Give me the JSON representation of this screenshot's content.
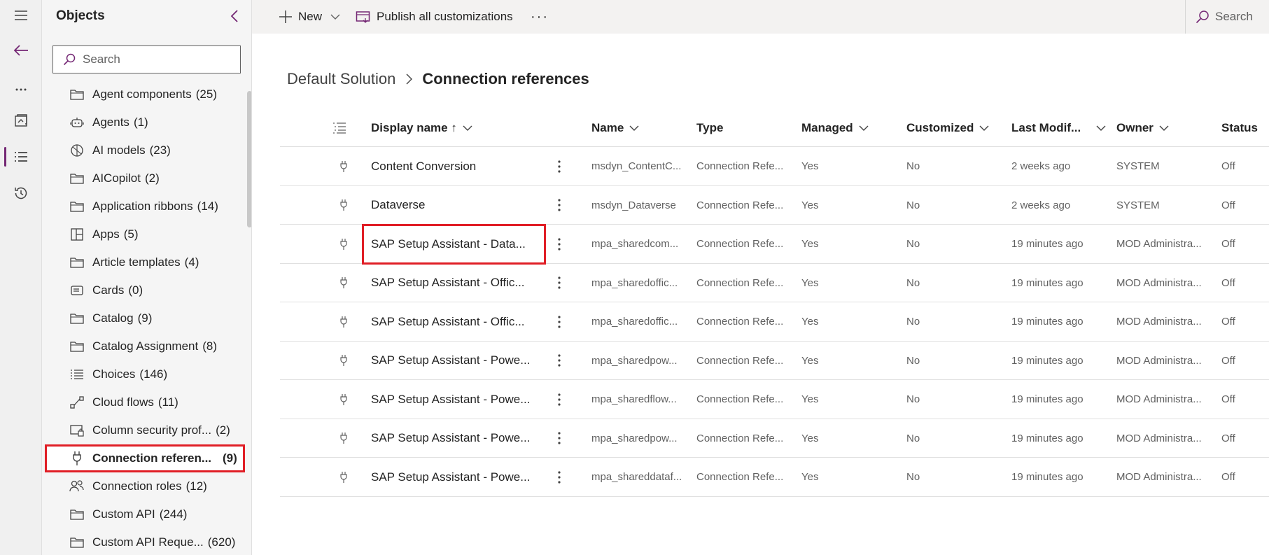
{
  "rail": {
    "items": [
      {
        "icon": "hamburger-menu-icon"
      },
      {
        "icon": "back-arrow-icon"
      },
      {
        "icon": "more-dots-icon"
      },
      {
        "icon": "solution-icon"
      },
      {
        "icon": "objects-list-icon"
      },
      {
        "icon": "history-icon"
      }
    ]
  },
  "objects": {
    "title": "Objects",
    "search_placeholder": "Search",
    "items": [
      {
        "label": "Agent components",
        "count": "(25)",
        "icon": "folder-icon"
      },
      {
        "label": "Agents",
        "count": "(1)",
        "icon": "bot-icon"
      },
      {
        "label": "AI models",
        "count": "(23)",
        "icon": "ai-model-icon"
      },
      {
        "label": "AICopilot",
        "count": "(2)",
        "icon": "folder-icon"
      },
      {
        "label": "Application ribbons",
        "count": "(14)",
        "icon": "folder-icon"
      },
      {
        "label": "Apps",
        "count": "(5)",
        "icon": "apps-icon"
      },
      {
        "label": "Article templates",
        "count": "(4)",
        "icon": "folder-icon"
      },
      {
        "label": "Cards",
        "count": "(0)",
        "icon": "card-icon"
      },
      {
        "label": "Catalog",
        "count": "(9)",
        "icon": "folder-icon"
      },
      {
        "label": "Catalog Assignment",
        "count": "(8)",
        "icon": "folder-icon"
      },
      {
        "label": "Choices",
        "count": "(146)",
        "icon": "list-icon"
      },
      {
        "label": "Cloud flows",
        "count": "(11)",
        "icon": "flow-icon"
      },
      {
        "label": "Column security prof...",
        "count": "(2)",
        "icon": "security-profile-icon"
      },
      {
        "label": "Connection referen...",
        "count": "(9)",
        "icon": "plug-icon",
        "selected": true
      },
      {
        "label": "Connection roles",
        "count": "(12)",
        "icon": "people-icon"
      },
      {
        "label": "Custom API",
        "count": "(244)",
        "icon": "folder-icon"
      },
      {
        "label": "Custom API Reque...",
        "count": "(620)",
        "icon": "folder-icon"
      }
    ]
  },
  "commandbar": {
    "new_label": "New",
    "publish_label": "Publish all customizations",
    "more_label": "···",
    "search_label": "Search"
  },
  "breadcrumb": {
    "root": "Default Solution",
    "current": "Connection references"
  },
  "grid": {
    "headers": {
      "display_name": "Display name ↑",
      "name": "Name",
      "type": "Type",
      "managed": "Managed",
      "customized": "Customized",
      "last_modified": "Last Modif...",
      "owner": "Owner",
      "status": "Status"
    },
    "rows": [
      {
        "display_name": "Content Conversion",
        "name": "msdyn_ContentC...",
        "type": "Connection Refe...",
        "managed": "Yes",
        "customized": "No",
        "last_modified": "2 weeks ago",
        "owner": "SYSTEM",
        "status": "Off"
      },
      {
        "display_name": "Dataverse",
        "name": "msdyn_Dataverse",
        "type": "Connection Refe...",
        "managed": "Yes",
        "customized": "No",
        "last_modified": "2 weeks ago",
        "owner": "SYSTEM",
        "status": "Off"
      },
      {
        "display_name": "SAP Setup Assistant - Data...",
        "name": "mpa_sharedcom...",
        "type": "Connection Refe...",
        "managed": "Yes",
        "customized": "No",
        "last_modified": "19 minutes ago",
        "owner": "MOD Administra...",
        "status": "Off",
        "highlight": true
      },
      {
        "display_name": "SAP Setup Assistant - Offic...",
        "name": "mpa_sharedoffic...",
        "type": "Connection Refe...",
        "managed": "Yes",
        "customized": "No",
        "last_modified": "19 minutes ago",
        "owner": "MOD Administra...",
        "status": "Off"
      },
      {
        "display_name": "SAP Setup Assistant - Offic...",
        "name": "mpa_sharedoffic...",
        "type": "Connection Refe...",
        "managed": "Yes",
        "customized": "No",
        "last_modified": "19 minutes ago",
        "owner": "MOD Administra...",
        "status": "Off"
      },
      {
        "display_name": "SAP Setup Assistant - Powe...",
        "name": "mpa_sharedpow...",
        "type": "Connection Refe...",
        "managed": "Yes",
        "customized": "No",
        "last_modified": "19 minutes ago",
        "owner": "MOD Administra...",
        "status": "Off"
      },
      {
        "display_name": "SAP Setup Assistant - Powe...",
        "name": "mpa_sharedflow...",
        "type": "Connection Refe...",
        "managed": "Yes",
        "customized": "No",
        "last_modified": "19 minutes ago",
        "owner": "MOD Administra...",
        "status": "Off"
      },
      {
        "display_name": "SAP Setup Assistant - Powe...",
        "name": "mpa_sharedpow...",
        "type": "Connection Refe...",
        "managed": "Yes",
        "customized": "No",
        "last_modified": "19 minutes ago",
        "owner": "MOD Administra...",
        "status": "Off"
      },
      {
        "display_name": "SAP Setup Assistant - Powe...",
        "name": "mpa_shareddataf...",
        "type": "Connection Refe...",
        "managed": "Yes",
        "customized": "No",
        "last_modified": "19 minutes ago",
        "owner": "MOD Administra...",
        "status": "Off"
      }
    ]
  },
  "colors": {
    "accent": "#742774",
    "highlight_border": "#e01e26",
    "commandbar_bg": "#f3f2f1",
    "panel_bg": "#f5f5f5"
  }
}
